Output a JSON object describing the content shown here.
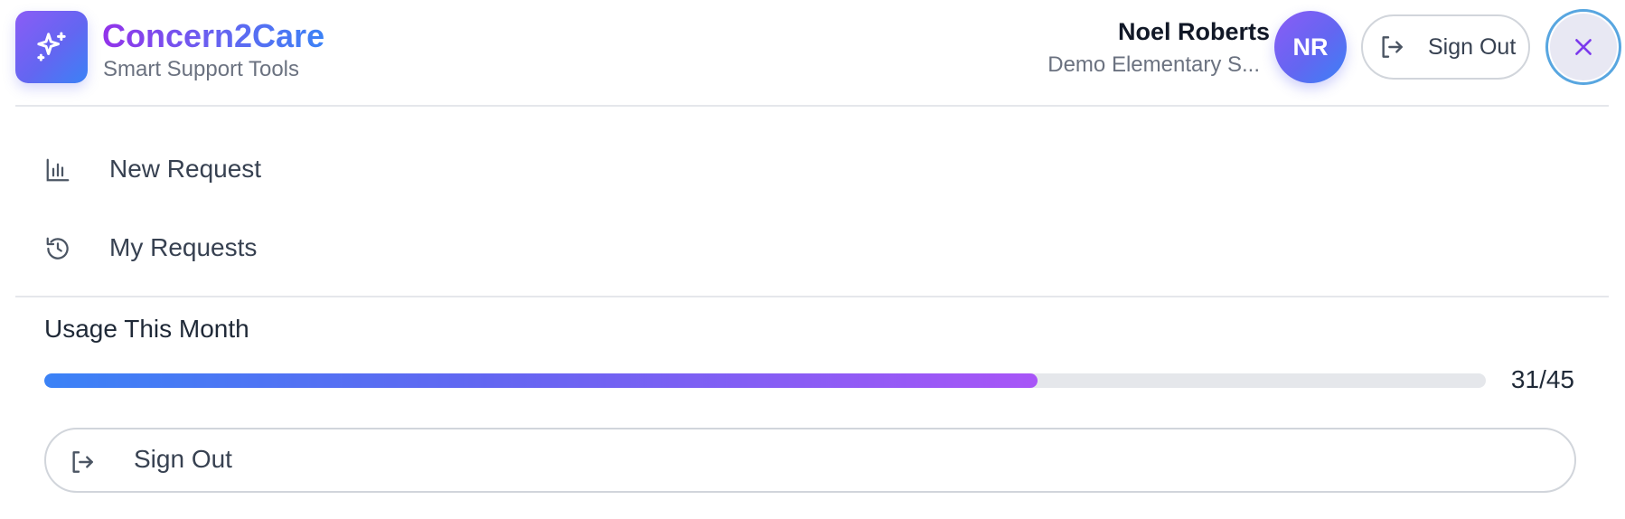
{
  "header": {
    "brand_title": "Concern2Care",
    "brand_subtitle": "Smart Support Tools",
    "user_name": "Noel Roberts",
    "user_school": "Demo Elementary S...",
    "avatar_initials": "NR",
    "sign_out_label": "Sign Out",
    "logo_icon": "sparkles-icon",
    "close_icon": "close-icon"
  },
  "nav": {
    "items": [
      {
        "label": "New Request",
        "icon": "bar-chart-icon"
      },
      {
        "label": "My Requests",
        "icon": "history-icon"
      }
    ]
  },
  "usage": {
    "title": "Usage This Month",
    "count_label": "31/45",
    "used": 31,
    "limit": 45
  },
  "footer": {
    "sign_out_label": "Sign Out",
    "icon": "sign-out-icon"
  },
  "colors": {
    "brand_purple": "#8b5cf6",
    "brand_indigo": "#6366f1",
    "brand_blue": "#3b82f6",
    "close_ring": "#58a6e0"
  }
}
